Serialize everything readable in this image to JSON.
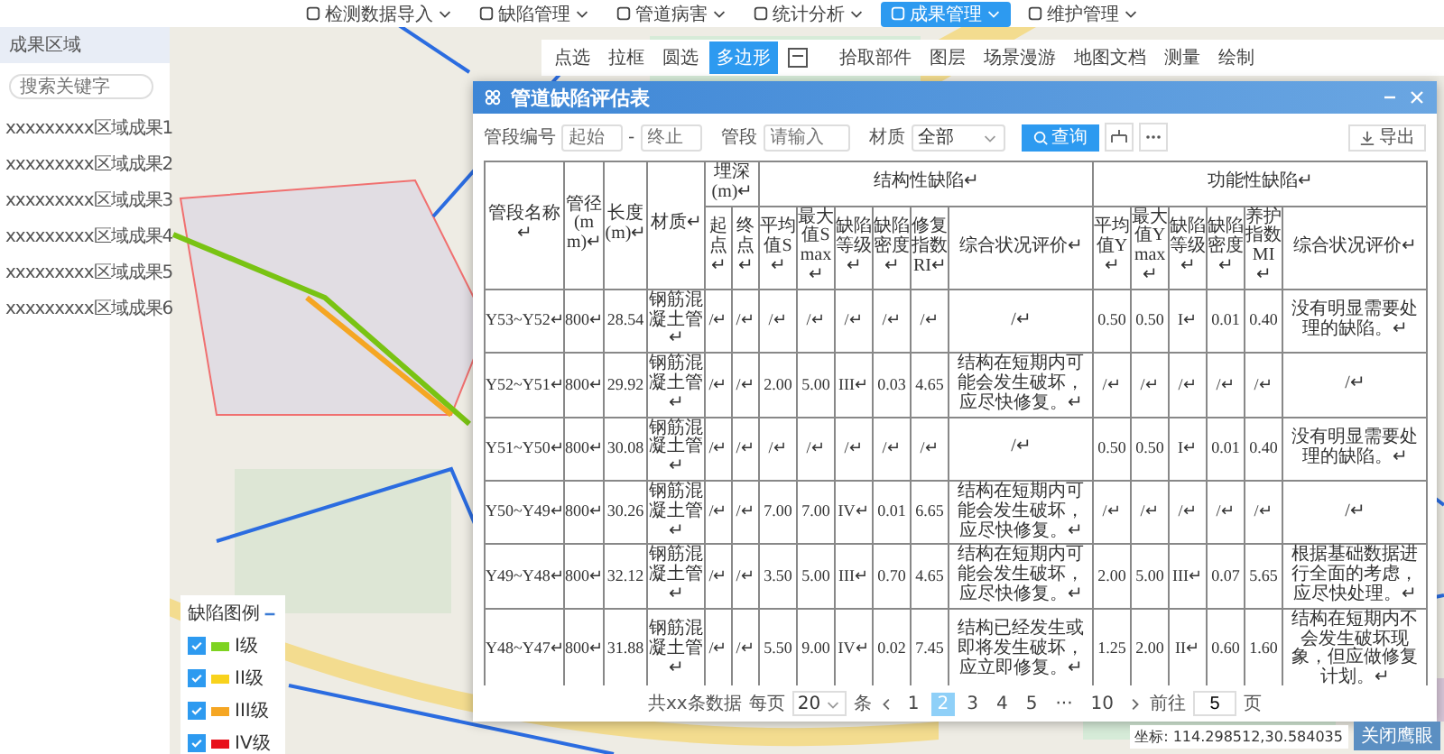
{
  "top_menu": [
    {
      "label": "检测数据导入",
      "selected": false
    },
    {
      "label": "缺陷管理",
      "selected": false
    },
    {
      "label": "管道病害",
      "selected": false
    },
    {
      "label": "统计分析",
      "selected": false
    },
    {
      "label": "成果管理",
      "selected": true
    },
    {
      "label": "维护管理",
      "selected": false
    }
  ],
  "region_panel": {
    "title": "成果区域",
    "search": {
      "placeholder": "搜索关键字"
    },
    "items": [
      "xxxxxxxxx区域成果1",
      "xxxxxxxxx区域成果2",
      "xxxxxxxxx区域成果3",
      "xxxxxxxxx区域成果4",
      "xxxxxxxxx区域成果5",
      "xxxxxxxxx区域成果6"
    ]
  },
  "map_tools": [
    {
      "label": "点选",
      "selected": false
    },
    {
      "label": "拉框",
      "selected": false
    },
    {
      "label": "圆选",
      "selected": false
    },
    {
      "label": "多边形",
      "selected": true
    }
  ],
  "map_tools_right": [
    "拾取部件",
    "图层",
    "场景漫游",
    "地图文档",
    "测量",
    "绘制"
  ],
  "dialog": {
    "title": "管道缺陷评估表",
    "filters": {
      "pipe_no_label": "管段编号",
      "from_placeholder": "起始",
      "separator": "-",
      "to_placeholder": "终止",
      "segment_label": "管段",
      "segment_placeholder": "请输入",
      "material_label": "材质",
      "material_value": "全部"
    },
    "query_button": "查询",
    "export_button": "导出",
    "header_rows": [
      [
        {
          "label": "管段名称↵",
          "rowspan": 2
        },
        {
          "label": "管径(mm)↵",
          "rowspan": 2
        },
        {
          "label": "长度(m)↵",
          "rowspan": 2
        },
        {
          "label": "材质↵",
          "rowspan": 2
        },
        {
          "label": "埋深(m)↵",
          "colspan": 2
        },
        {
          "label": "结构性缺陷↵",
          "colspan": 6
        },
        {
          "label": "功能性缺陷↵",
          "colspan": 6
        }
      ],
      [
        {
          "label": "起点↵"
        },
        {
          "label": "终点↵"
        },
        {
          "label": "平均值S↵"
        },
        {
          "label": "最大值Smax↵"
        },
        {
          "label": "缺陷等级↵"
        },
        {
          "label": "缺陷密度↵"
        },
        {
          "label": "修复指数RI↵"
        },
        {
          "label": "综合状况评价↵"
        },
        {
          "label": "平均值Y↵"
        },
        {
          "label": "最大值Ymax↵"
        },
        {
          "label": "缺陷等级↵"
        },
        {
          "label": "缺陷密度↵"
        },
        {
          "label": "养护指数MI↵"
        },
        {
          "label": "综合状况评价↵"
        }
      ]
    ],
    "rows": [
      [
        "Y53~Y52↵",
        "800↵",
        "28.54",
        "钢筋混凝土管↵",
        "/↵",
        "/↵",
        "/↵",
        "/↵",
        "/↵",
        "/↵",
        "/↵",
        "/↵",
        "0.50",
        "0.50",
        "I↵",
        "0.01",
        "0.40",
        "没有明显需要处理的缺陷。↵"
      ],
      [
        "Y52~Y51↵",
        "800↵",
        "29.92",
        "钢筋混凝土管↵",
        "/↵",
        "/↵",
        "2.00",
        "5.00",
        "III↵",
        "0.03",
        "4.65",
        "结构在短期内可能会发生破坏，应尽快修复。↵",
        "/↵",
        "/↵",
        "/↵",
        "/↵",
        "/↵",
        "/↵"
      ],
      [
        "Y51~Y50↵",
        "800↵",
        "30.08",
        "钢筋混凝土管↵",
        "/↵",
        "/↵",
        "/↵",
        "/↵",
        "/↵",
        "/↵",
        "/↵",
        "/↵",
        "0.50",
        "0.50",
        "I↵",
        "0.01",
        "0.40",
        "没有明显需要处理的缺陷。↵"
      ],
      [
        "Y50~Y49↵",
        "800↵",
        "30.26",
        "钢筋混凝土管↵",
        "/↵",
        "/↵",
        "7.00",
        "7.00",
        "IV↵",
        "0.01",
        "6.65",
        "结构在短期内可能会发生破坏，应尽快修复。↵",
        "/↵",
        "/↵",
        "/↵",
        "/↵",
        "/↵",
        "/↵"
      ],
      [
        "Y49~Y48↵",
        "800↵",
        "32.12",
        "钢筋混凝土管↵",
        "/↵",
        "/↵",
        "3.50",
        "5.00",
        "III↵",
        "0.70",
        "4.65",
        "结构在短期内可能会发生破坏，应尽快修复。↵",
        "2.00",
        "5.00",
        "III↵",
        "0.07",
        "5.65",
        "根据基础数据进行全面的考虑，应尽快处理。↵"
      ],
      [
        "Y48~Y47↵",
        "800↵",
        "31.88",
        "钢筋混凝土管↵",
        "/↵",
        "/↵",
        "5.50",
        "9.00",
        "IV↵",
        "0.02",
        "7.45",
        "结构已经发生或即将发生破坏，应立即修复。↵",
        "1.25",
        "2.00",
        "II↵",
        "0.60",
        "1.60",
        "结构在短期内不会发生破坏现象，但应做修复计划。↵"
      ]
    ],
    "pagination": {
      "total": "共xx条数据",
      "per_page_label": "每页",
      "per_page": "20",
      "per_page_unit": "条",
      "pages": [
        {
          "label": "1",
          "selected": false
        },
        {
          "label": "2",
          "selected": true
        },
        {
          "label": "3",
          "selected": false
        },
        {
          "label": "4",
          "selected": false
        },
        {
          "label": "5",
          "selected": false
        },
        {
          "label": "···",
          "selected": false
        },
        {
          "label": "10",
          "selected": false
        }
      ],
      "goto_label": "前往",
      "goto_value": "5",
      "goto_unit": "页"
    }
  },
  "legend": {
    "title": "缺陷图例",
    "items": [
      {
        "label": "I级",
        "color": "#7ed321",
        "checked": true
      },
      {
        "label": "II级",
        "color": "#f8d21c",
        "checked": true
      },
      {
        "label": "III级",
        "color": "#f5a623",
        "checked": true
      },
      {
        "label": "IV级",
        "color": "#e8101a",
        "checked": true
      }
    ]
  },
  "status": {
    "coordinates": "坐标: 114.298512,30.584035",
    "overview_button": "关闭鹰眼"
  }
}
